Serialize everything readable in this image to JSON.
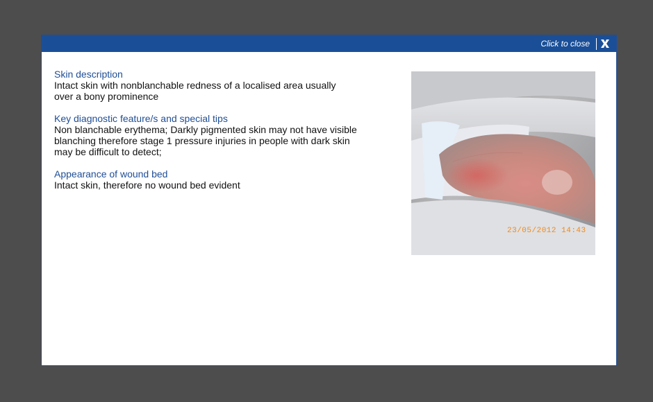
{
  "modal": {
    "close_label": "Click to close",
    "close_icon": "close-x-icon",
    "accent_color": "#1a4f98"
  },
  "sections": [
    {
      "title": "Skin description",
      "body": "Intact skin with nonblanchable redness of a localised area usually over a bony prominence"
    },
    {
      "title": "Key diagnostic feature/s and special tips",
      "body": "Non blanchable erythema; Darkly pigmented skin may not have visible blanching therefore stage 1 pressure injuries in people with dark skin may be difficult to detect;"
    },
    {
      "title": "Appearance of wound bed",
      "body": "Intact skin, therefore no wound bed evident"
    }
  ],
  "photo": {
    "timestamp": "23/05/2012 14:43"
  }
}
